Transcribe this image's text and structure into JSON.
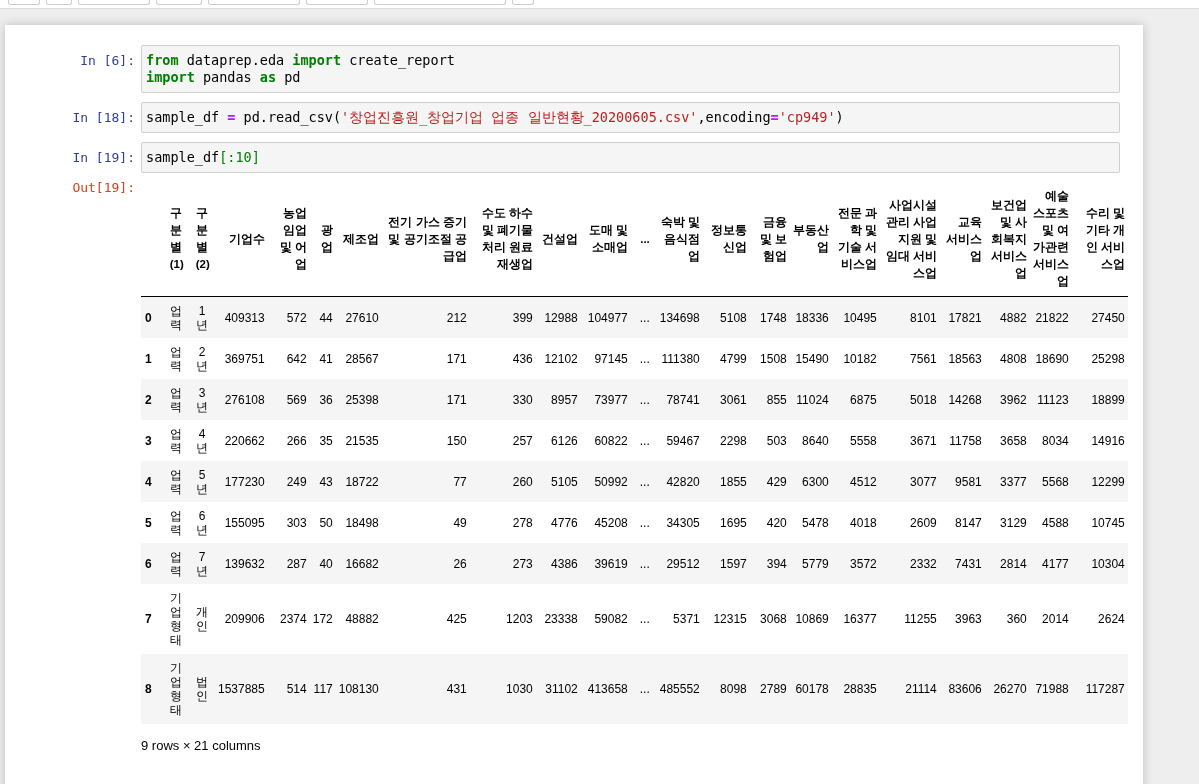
{
  "cells": [
    {
      "prompt": "In [6]:",
      "lines": [
        [
          {
            "kind": "keyword",
            "text": "from"
          },
          {
            "kind": "plain",
            "text": " dataprep.eda "
          },
          {
            "kind": "keyword",
            "text": "import"
          },
          {
            "kind": "plain",
            "text": " create_report"
          }
        ],
        [
          {
            "kind": "keyword",
            "text": "import"
          },
          {
            "kind": "plain",
            "text": " pandas "
          },
          {
            "kind": "keyword",
            "text": "as"
          },
          {
            "kind": "plain",
            "text": " pd"
          }
        ]
      ]
    },
    {
      "prompt": "In [18]:",
      "lines": [
        [
          {
            "kind": "plain",
            "text": "sample_df "
          },
          {
            "kind": "operator",
            "text": "="
          },
          {
            "kind": "plain",
            "text": " pd.read_csv("
          },
          {
            "kind": "string",
            "text": "'창업진흥원_창업기업 업종 일반현황_20200605.csv'"
          },
          {
            "kind": "plain",
            "text": ",encoding"
          },
          {
            "kind": "operator",
            "text": "="
          },
          {
            "kind": "string",
            "text": "'cp949'"
          },
          {
            "kind": "plain",
            "text": ")"
          }
        ]
      ]
    },
    {
      "prompt": "In [19]:",
      "lines": [
        [
          {
            "kind": "plain",
            "text": "sample_df"
          },
          {
            "kind": "bracket",
            "text": "[:"
          },
          {
            "kind": "number",
            "text": "10"
          },
          {
            "kind": "bracket",
            "text": "]"
          }
        ]
      ]
    }
  ],
  "output": {
    "prompt": "Out[19]:",
    "table": {
      "columns": [
        "",
        "구분별(1)",
        "구분별(2)",
        "기업수",
        "농업 임업 및 어업",
        "광업",
        "제조업",
        "전기 가스 증기 및 공기조절 공급업",
        "수도 하수 및 폐기물 처리 원료 재생업",
        "건설업",
        "도매 및 소매업",
        "...",
        "숙박 및 음식점업",
        "정보통신업",
        "금융 및 보험업",
        "부동산업",
        "전문 과학 및 기술 서비스업",
        "사업시설 관리 사업 지원 및 임대 서비스업",
        "교육 서비스업",
        "보건업 및 사회복지 서비스업",
        "예술 스포츠 및 여가관련 서비스업",
        "수리 및 기타 개인 서비스업"
      ],
      "rows": [
        [
          "0",
          "업력",
          "1년",
          "409313",
          "572",
          "44",
          "27610",
          "212",
          "399",
          "12988",
          "104977",
          "...",
          "134698",
          "5108",
          "1748",
          "18336",
          "10495",
          "8101",
          "17821",
          "4882",
          "21822",
          "27450"
        ],
        [
          "1",
          "업력",
          "2년",
          "369751",
          "642",
          "41",
          "28567",
          "171",
          "436",
          "12102",
          "97145",
          "...",
          "111380",
          "4799",
          "1508",
          "15490",
          "10182",
          "7561",
          "18563",
          "4808",
          "18690",
          "25298"
        ],
        [
          "2",
          "업력",
          "3년",
          "276108",
          "569",
          "36",
          "25398",
          "171",
          "330",
          "8957",
          "73977",
          "...",
          "78741",
          "3061",
          "855",
          "11024",
          "6875",
          "5018",
          "14268",
          "3962",
          "11123",
          "18899"
        ],
        [
          "3",
          "업력",
          "4년",
          "220662",
          "266",
          "35",
          "21535",
          "150",
          "257",
          "6126",
          "60822",
          "...",
          "59467",
          "2298",
          "503",
          "8640",
          "5558",
          "3671",
          "11758",
          "3658",
          "8034",
          "14916"
        ],
        [
          "4",
          "업력",
          "5년",
          "177230",
          "249",
          "43",
          "18722",
          "77",
          "260",
          "5105",
          "50992",
          "...",
          "42820",
          "1855",
          "429",
          "6300",
          "4512",
          "3077",
          "9581",
          "3377",
          "5568",
          "12299"
        ],
        [
          "5",
          "업력",
          "6년",
          "155095",
          "303",
          "50",
          "18498",
          "49",
          "278",
          "4776",
          "45208",
          "...",
          "34305",
          "1695",
          "420",
          "5478",
          "4018",
          "2609",
          "8147",
          "3129",
          "4588",
          "10745"
        ],
        [
          "6",
          "업력",
          "7년",
          "139632",
          "287",
          "40",
          "16682",
          "26",
          "273",
          "4386",
          "39619",
          "...",
          "29512",
          "1597",
          "394",
          "5779",
          "3572",
          "2332",
          "7431",
          "2814",
          "4177",
          "10304"
        ],
        [
          "7",
          "기업형태",
          "개인",
          "209906",
          "2374",
          "172",
          "48882",
          "425",
          "1203",
          "23338",
          "59082",
          "...",
          "5371",
          "12315",
          "3068",
          "10869",
          "16377",
          "11255",
          "3963",
          "360",
          "2014",
          "2624"
        ],
        [
          "8",
          "기업형태",
          "법인",
          "1537885",
          "514",
          "117",
          "108130",
          "431",
          "1030",
          "31102",
          "413658",
          "...",
          "485552",
          "8098",
          "2789",
          "60178",
          "28835",
          "21114",
          "83606",
          "26270",
          "71988",
          "117287"
        ]
      ],
      "footer": "9 rows × 21 columns"
    }
  }
}
